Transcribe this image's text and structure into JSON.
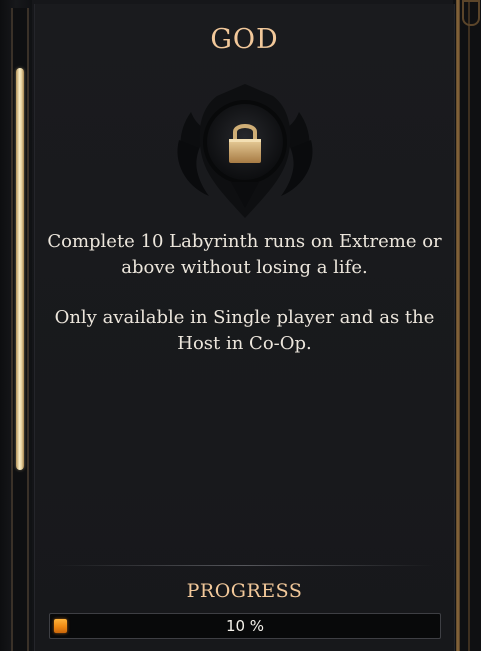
{
  "achievement": {
    "title": "GOD",
    "locked": true,
    "emblem_icon": "locked-emblem-icon",
    "description": [
      "Complete 10 Labyrinth runs on Extreme or above without losing a life.",
      "Only available in Single player and as the Host in Co-Op."
    ]
  },
  "progress": {
    "label": "PROGRESS",
    "fraction": 0.1,
    "text": "10 %"
  },
  "colors": {
    "accent_gold": "#f2c89a",
    "progress_fill": "#f08a14",
    "text": "#ece6dc",
    "background": "#17181b"
  }
}
